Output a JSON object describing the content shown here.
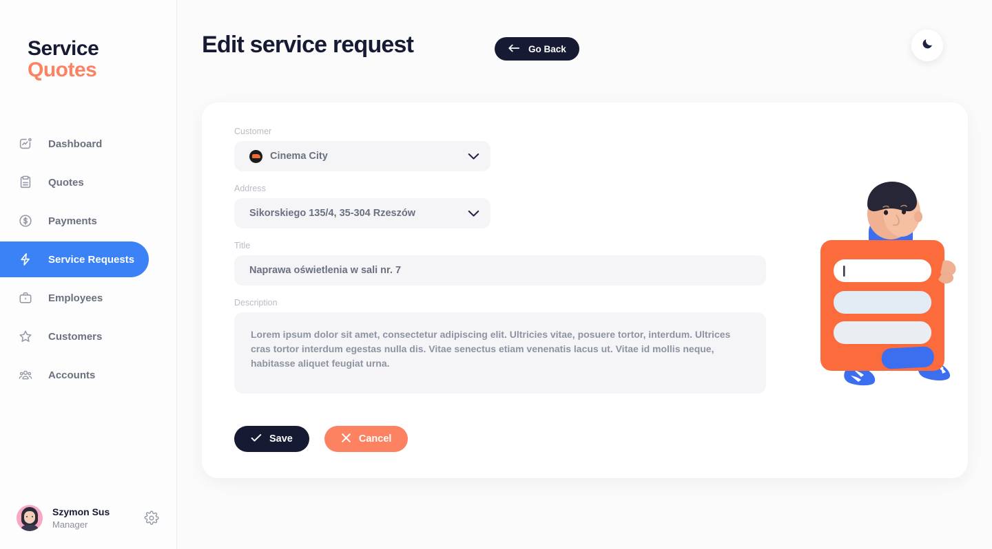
{
  "brand": {
    "line1": "Service",
    "line2": "Quotes",
    "accent": "#fc8262",
    "dark": "#161b33"
  },
  "sidebar": {
    "items": [
      {
        "label": "Dashboard",
        "icon": "chart-square-icon",
        "active": false
      },
      {
        "label": "Quotes",
        "icon": "clipboard-icon",
        "active": false
      },
      {
        "label": "Payments",
        "icon": "dollar-circle-icon",
        "active": false
      },
      {
        "label": "Service Requests",
        "icon": "lightning-icon",
        "active": true
      },
      {
        "label": "Employees",
        "icon": "briefcase-icon",
        "active": false
      },
      {
        "label": "Customers",
        "icon": "star-icon",
        "active": false
      },
      {
        "label": "Accounts",
        "icon": "people-icon",
        "active": false
      }
    ],
    "profile": {
      "name": "Szymon Sus",
      "role": "Manager",
      "settings_icon": "gear-icon"
    },
    "active_color": "#3b82f6"
  },
  "header": {
    "title": "Edit service request",
    "go_back_label": "Go Back",
    "go_back_icon": "arrow-left-icon",
    "theme_toggle_icon": "moon-icon"
  },
  "form": {
    "customer": {
      "label": "Customer",
      "value": "Cinema City",
      "logo_icon": "cinema-city-logo-icon",
      "chevron_icon": "chevron-down-icon"
    },
    "address": {
      "label": "Address",
      "value": "Sikorskiego 135/4, 35-304 Rzeszów",
      "chevron_icon": "chevron-down-icon"
    },
    "title": {
      "label": "Title",
      "value": "Naprawa oświetlenia w sali nr. 7"
    },
    "description": {
      "label": "Description",
      "value": "Lorem ipsum dolor sit amet, consectetur adipiscing elit. Ultricies vitae, posuere tortor, interdum. Ultrices cras tortor interdum egestas nulla dis. Vitae senectus etiam venenatis lacus ut. Vitae id mollis neque, habitasse aliquet feugiat urna."
    },
    "save": {
      "label": "Save",
      "icon": "check-icon",
      "color": "#161b33"
    },
    "cancel": {
      "label": "Cancel",
      "icon": "x-icon",
      "color": "#fc8262"
    }
  },
  "illustration": {
    "name": "person-holding-form-illustration",
    "card_color": "#fb6b3c",
    "button_color": "#3b6ff0",
    "shoe_color": "#3b6ff0"
  }
}
